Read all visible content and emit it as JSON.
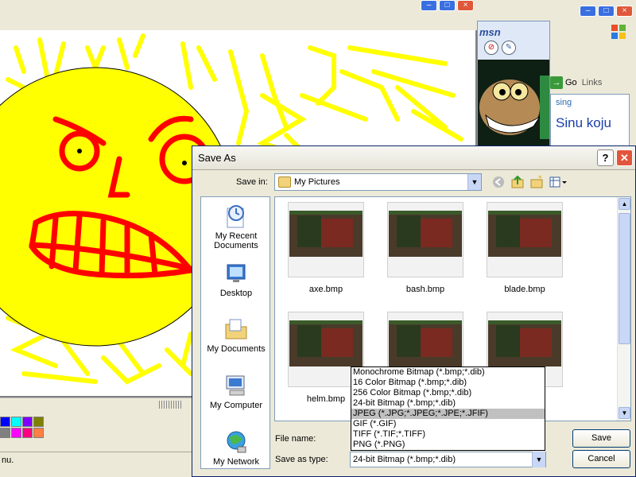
{
  "paint": {
    "status_text": "nu.",
    "palette_colors": [
      "#0000ff",
      "#00ffff",
      "#8000ff",
      "#808000",
      "#808080",
      "#ff00ff",
      "#ff0080",
      "#ff8040"
    ]
  },
  "ie": {
    "go_label": "Go",
    "links_label": "Links",
    "content_partial": "sing",
    "content_large": "Sinu koju"
  },
  "msn": {
    "logo": "msn"
  },
  "dialog": {
    "title": "Save As",
    "help_label": "?",
    "close_label": "✕",
    "save_in_label": "Save in:",
    "save_in_value": "My Pictures",
    "places": [
      {
        "label": "My Recent\nDocuments",
        "icon": "recent-documents-icon"
      },
      {
        "label": "Desktop",
        "icon": "desktop-icon"
      },
      {
        "label": "My Documents",
        "icon": "my-documents-icon"
      },
      {
        "label": "My Computer",
        "icon": "my-computer-icon"
      },
      {
        "label": "My Network",
        "icon": "my-network-icon"
      }
    ],
    "files": [
      {
        "name": "axe.bmp"
      },
      {
        "name": "bash.bmp"
      },
      {
        "name": "blade.bmp"
      },
      {
        "name": "helm.bmp"
      },
      {
        "name": ""
      },
      {
        "name": ""
      }
    ],
    "file_name_label": "File name:",
    "save_as_type_label": "Save as type:",
    "save_as_type_value": "24-bit Bitmap (*.bmp;*.dib)",
    "save_button": "Save",
    "cancel_button": "Cancel",
    "type_options": [
      "Monochrome Bitmap (*.bmp;*.dib)",
      "16 Color Bitmap (*.bmp;*.dib)",
      "256 Color Bitmap (*.bmp;*.dib)",
      "24-bit Bitmap (*.bmp;*.dib)",
      "JPEG (*.JPG;*.JPEG;*.JPE;*.JFIF)",
      "GIF (*.GIF)",
      "TIFF (*.TIF;*.TIFF)",
      "PNG (*.PNG)"
    ],
    "type_highlighted": "JPEG (*.JPG;*.JPEG;*.JPE;*.JFIF)"
  },
  "colors": {
    "drawing_fill": "#ffff00",
    "drawing_stroke": "#ff0000"
  }
}
